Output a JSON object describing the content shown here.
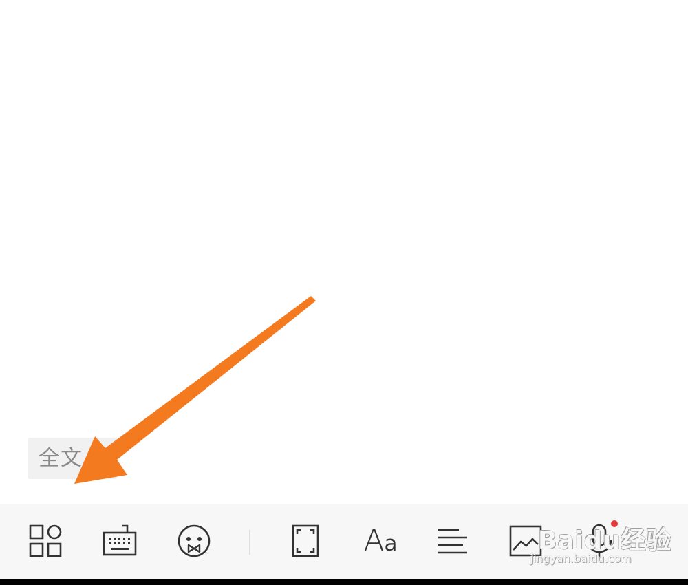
{
  "editor": {
    "chip_label": "全文"
  },
  "toolbar": {
    "items": [
      {
        "name": "apps-grid-icon"
      },
      {
        "name": "keyboard-icon"
      },
      {
        "name": "emoji-icon"
      },
      {
        "name": "fullscreen-icon"
      },
      {
        "name": "font-format-icon",
        "label_big": "A",
        "label_small": "a"
      },
      {
        "name": "align-left-icon"
      },
      {
        "name": "image-insert-icon"
      },
      {
        "name": "microphone-icon",
        "has_notification_dot": true
      }
    ]
  },
  "colors": {
    "arrow": "#f47a20",
    "icon": "#333333",
    "notification_dot": "#e03a3a",
    "toolbar_bg": "#f7f7f7"
  },
  "watermark": {
    "main": "Baidu经验",
    "sub": "jingyan.baidu.com"
  }
}
